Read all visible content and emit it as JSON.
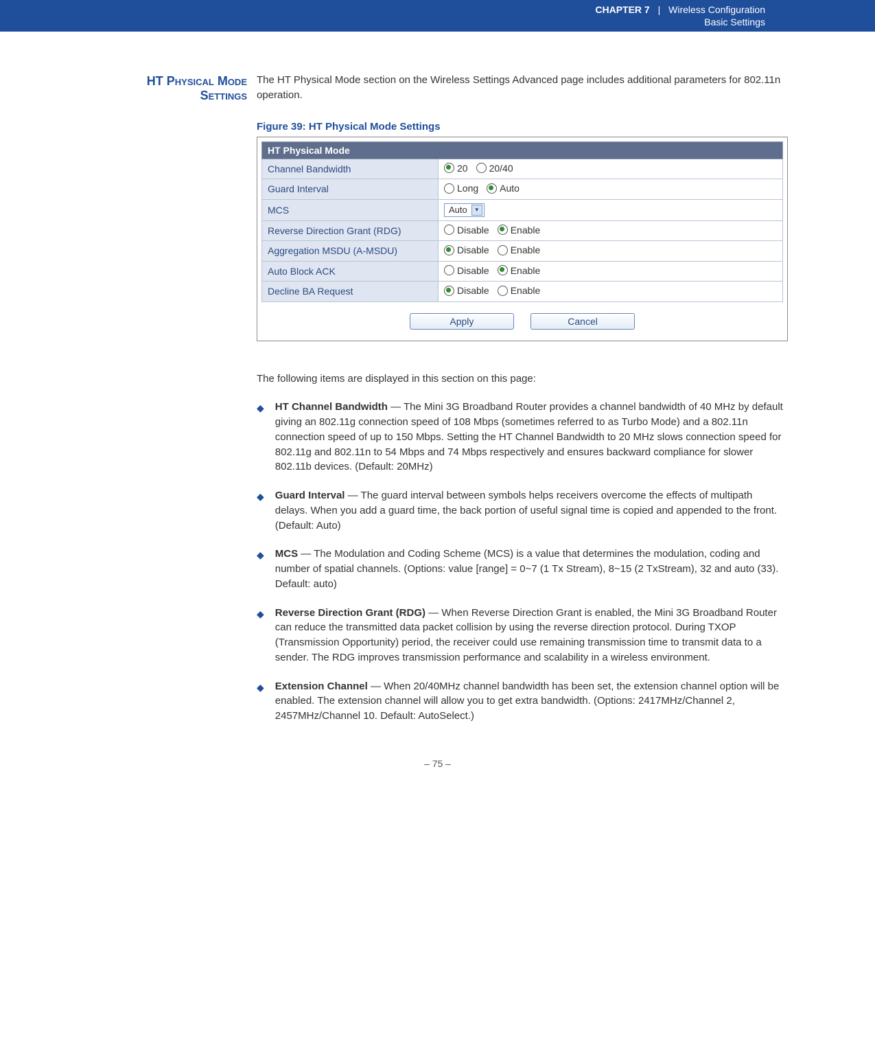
{
  "header": {
    "chapter": "Chapter 7",
    "title": "Wireless Configuration",
    "subtitle": "Basic Settings"
  },
  "side_title_l1": "HT Physical Mode",
  "side_title_l2": "Settings",
  "intro": "The HT Physical Mode section on the Wireless Settings Advanced page includes additional parameters for 802.11n operation.",
  "figure_caption": "Figure 39:  HT Physical Mode Settings",
  "table": {
    "heading": "HT Physical Mode",
    "rows": [
      {
        "label": "Channel Bandwidth",
        "opts": [
          {
            "t": "20",
            "sel": true
          },
          {
            "t": "20/40",
            "sel": false
          }
        ]
      },
      {
        "label": "Guard Interval",
        "opts": [
          {
            "t": "Long",
            "sel": false
          },
          {
            "t": "Auto",
            "sel": true
          }
        ]
      },
      {
        "label": "MCS",
        "select": "Auto"
      },
      {
        "label": "Reverse Direction Grant (RDG)",
        "opts": [
          {
            "t": "Disable",
            "sel": false
          },
          {
            "t": "Enable",
            "sel": true
          }
        ]
      },
      {
        "label": "Aggregation MSDU (A-MSDU)",
        "opts": [
          {
            "t": "Disable",
            "sel": true
          },
          {
            "t": "Enable",
            "sel": false
          }
        ]
      },
      {
        "label": "Auto Block ACK",
        "opts": [
          {
            "t": "Disable",
            "sel": false
          },
          {
            "t": "Enable",
            "sel": true
          }
        ]
      },
      {
        "label": "Decline BA Request",
        "opts": [
          {
            "t": "Disable",
            "sel": true
          },
          {
            "t": "Enable",
            "sel": false
          }
        ]
      }
    ],
    "apply": "Apply",
    "cancel": "Cancel"
  },
  "post_intro": "The following items are displayed in this section on this page:",
  "bullets": [
    {
      "term": "HT Channel Bandwidth",
      "text": " — The Mini 3G Broadband Router provides a channel bandwidth of 40 MHz by default giving an 802.11g connection speed of 108 Mbps (sometimes referred to as Turbo Mode) and a 802.11n connection speed of up to 150 Mbps. Setting the HT Channel Bandwidth to 20 MHz slows connection speed for 802.11g and 802.11n to 54 Mbps and 74 Mbps respectively and ensures backward compliance for slower 802.11b devices. (Default: 20MHz)"
    },
    {
      "term": "Guard Interval",
      "text": " — The guard interval between symbols helps receivers overcome the effects of multipath delays. When you add a guard time, the back portion of useful signal time is copied and appended to the front. (Default: Auto)"
    },
    {
      "term": "MCS",
      "text": " — The Modulation and Coding Scheme (MCS) is a value that determines the modulation, coding and number of spatial channels. (Options: value [range] = 0~7 (1 Tx Stream), 8~15 (2 TxStream), 32 and auto (33). Default: auto)"
    },
    {
      "term": "Reverse Direction Grant (RDG)",
      "text": " — When Reverse Direction Grant is enabled, the Mini 3G Broadband Router can reduce the transmitted data packet collision by using the reverse direction protocol. During TXOP (Transmission Opportunity) period, the receiver could use remaining transmission time to transmit data to a sender. The RDG improves transmission performance and scalability in a wireless environment."
    },
    {
      "term": "Extension Channel",
      "text": " — When 20/40MHz channel bandwidth has been set, the extension channel option will be enabled. The extension channel will allow you to get extra bandwidth. (Options: 2417MHz/Channel 2, 2457MHz/Channel 10. Default: AutoSelect.)"
    }
  ],
  "page_number": "–  75  –"
}
